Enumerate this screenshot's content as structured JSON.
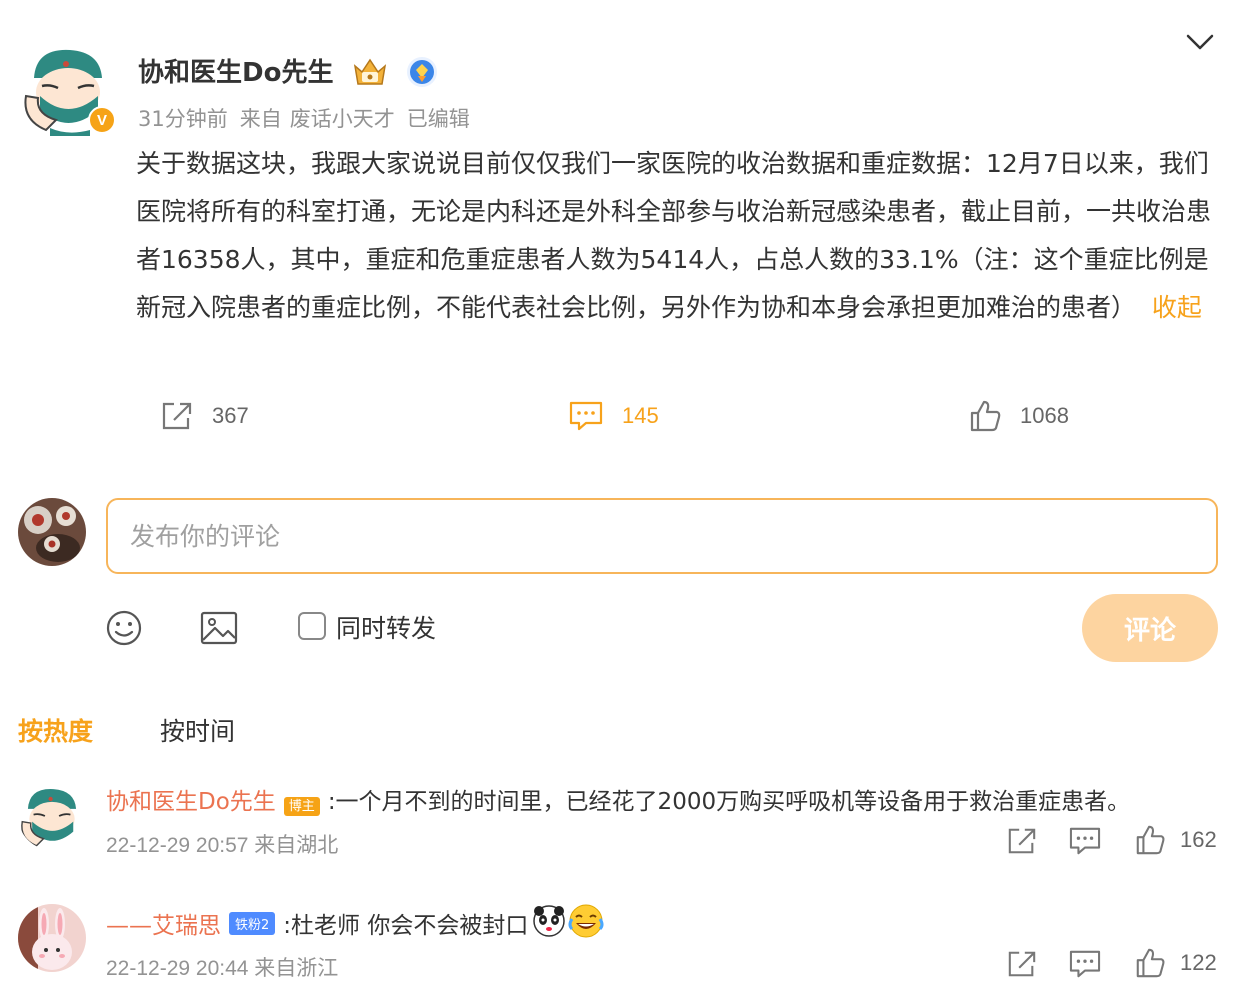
{
  "post": {
    "author": "协和医生Do先生",
    "verified_badge": "V",
    "time": "31分钟前",
    "source_prefix": "来自",
    "source": "废话小天才",
    "edited": "已编辑",
    "body": "关于数据这块，我跟大家说说目前仅仅我们一家医院的收治数据和重症数据：12月7日以来，我们医院将所有的科室打通，无论是内科还是外科全部参与收治新冠感染患者，截止目前，一共收治患者16358人，其中，重症和危重症患者人数为5414人，占总人数的33.1%（注：这个重症比例是新冠入院患者的重症比例，不能代表社会比例，另外作为协和本身会承担更加难治的患者）",
    "collapse_label": "收起",
    "repost_count": "367",
    "comment_count": "145",
    "like_count": "1068",
    "icons": [
      "crown-icon",
      "verified-icon",
      "chevron-down-icon",
      "share-icon",
      "comment-icon",
      "like-icon"
    ]
  },
  "composer": {
    "placeholder": "发布你的评论",
    "repost_label": "同时转发",
    "submit_label": "评论",
    "icons": [
      "emoji-icon",
      "image-icon"
    ]
  },
  "sort_tabs": [
    {
      "label": "按热度",
      "active": true
    },
    {
      "label": "按时间",
      "active": false
    }
  ],
  "comments": [
    {
      "author": "协和医生Do先生",
      "badge": "博主",
      "text": ":一个月不到的时间里，已经花了2000万购买呼吸机等设备用于救治重症患者。",
      "time": "22-12-29 20:57",
      "location": "来自湖北",
      "like_count": "162"
    },
    {
      "author": "——艾瑞思",
      "badge": "铁粉2",
      "text": ":杜老师 你会不会被封口",
      "time": "22-12-29 20:44",
      "location": "来自浙江",
      "like_count": "122"
    }
  ],
  "colors": {
    "accent": "#f7a21b",
    "comment_author": "#eb7350",
    "meta": "#939393",
    "submit_disabled": "#fdd4a0"
  }
}
